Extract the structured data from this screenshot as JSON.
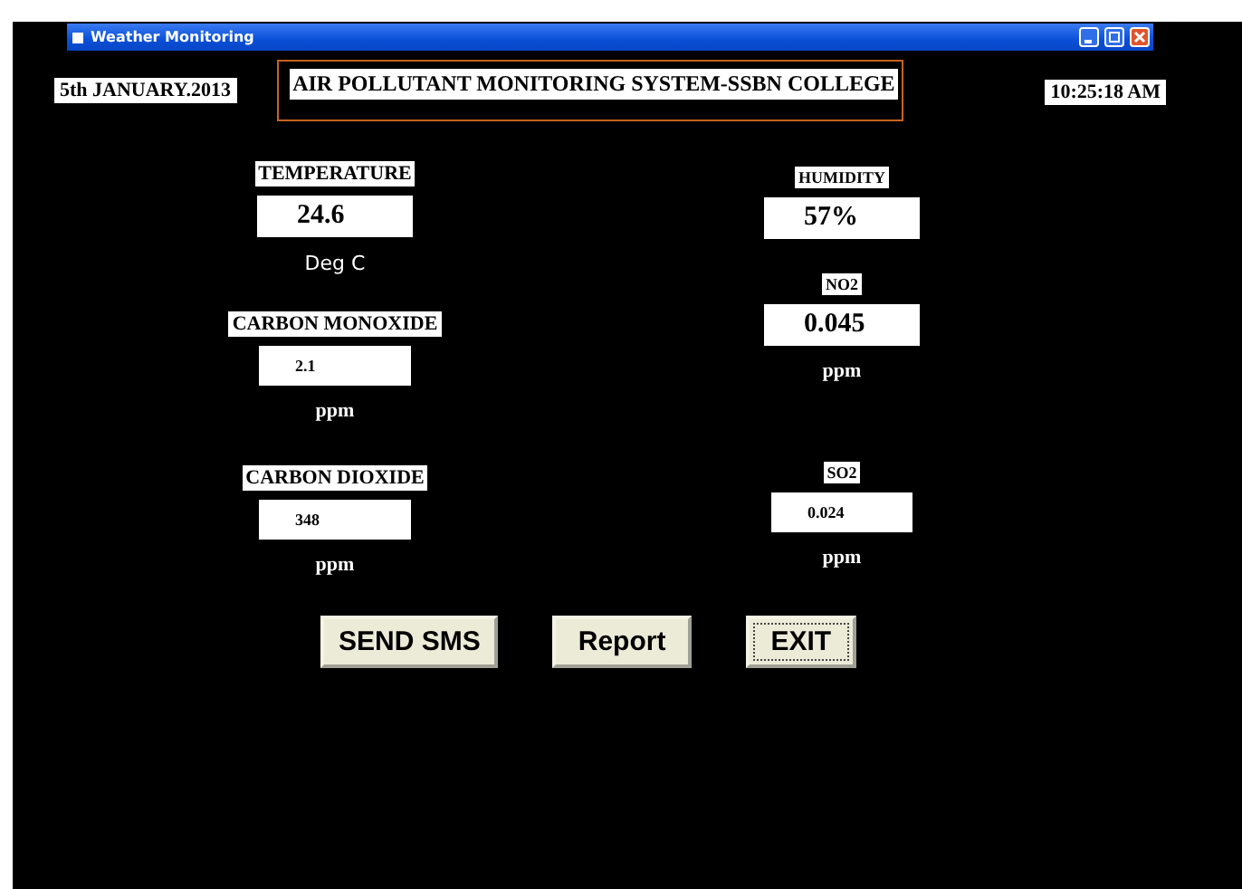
{
  "window": {
    "title": "Weather Monitoring"
  },
  "date": "5th JANUARY.2013",
  "heading": "AIR POLLUTANT MONITORING SYSTEM-SSBN COLLEGE",
  "time": "10:25:18 AM",
  "left_sensors": [
    {
      "label": "TEMPERATURE",
      "value": "24.6",
      "unit": "Deg C",
      "kind": "large"
    },
    {
      "label": "CARBON MONOXIDE",
      "value": "2.1",
      "unit": "ppm",
      "kind": "small"
    },
    {
      "label": "CARBON DIOXIDE",
      "value": "348",
      "unit": "ppm",
      "kind": "small"
    }
  ],
  "right_sensors": [
    {
      "label": "HUMIDITY",
      "value": "57%",
      "kind": "large"
    },
    {
      "label": "NO2",
      "value": "0.045",
      "unit": "ppm",
      "kind": "large"
    },
    {
      "label": "SO2",
      "value": "0.024",
      "unit": "ppm",
      "kind": "small"
    }
  ],
  "buttons": [
    {
      "label": "SEND SMS",
      "focused": false
    },
    {
      "label": "Report",
      "focused": false
    },
    {
      "label": "EXIT",
      "focused": true
    }
  ]
}
